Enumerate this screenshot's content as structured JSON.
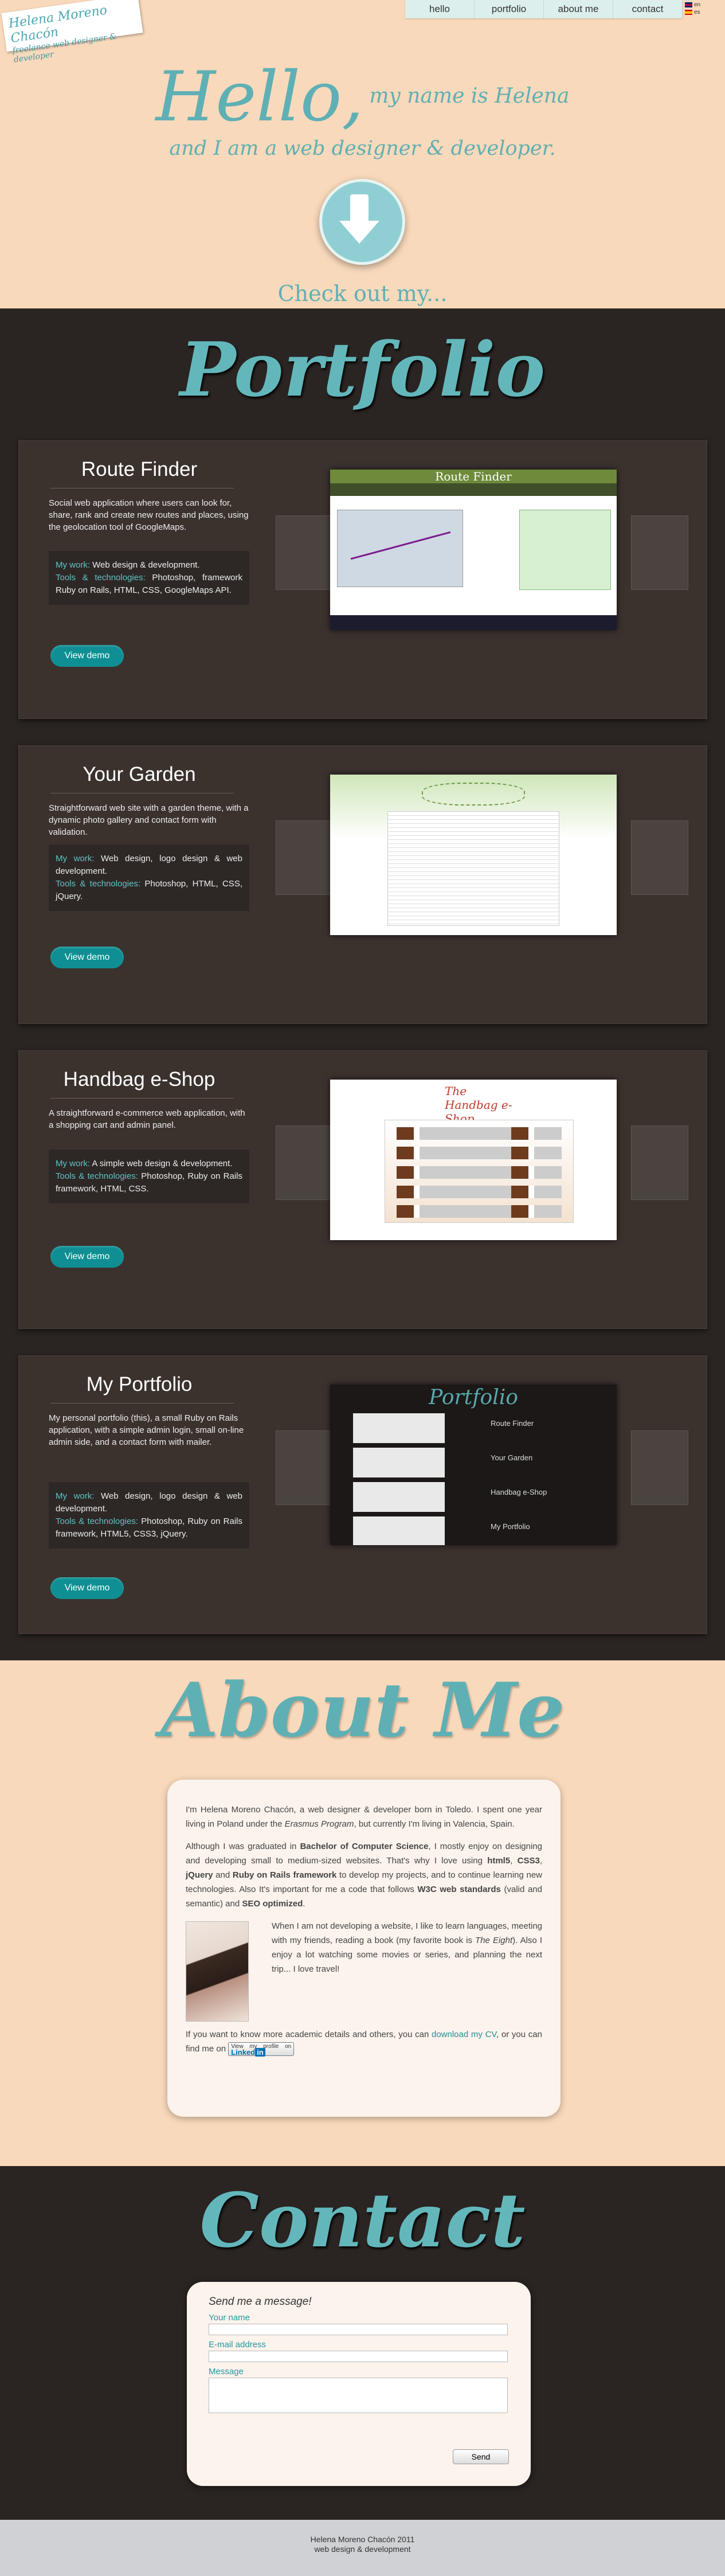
{
  "nav": {
    "items": [
      "hello",
      "portfolio",
      "about me",
      "contact"
    ],
    "languages": [
      "en",
      "es"
    ]
  },
  "logo": {
    "name": "Helena Moreno Chacón",
    "tagline": "freelance web designer & developer"
  },
  "hello": {
    "greeting": "Hello,",
    "line1": "my name is Helena",
    "line2": "and I am a web designer & developer.",
    "check_out": "Check out my..."
  },
  "portfolio": {
    "title": "Portfolio",
    "projects": [
      {
        "title": "Route Finder",
        "description": "Social web application where users can look for, share, rank and create new routes and places, using the geolocation tool of GoogleMaps.",
        "work_label": "My work:",
        "work": "Web design & development.",
        "tools_label": "Tools & technologies:",
        "tools": "Photoshop, framework Ruby on Rails, HTML, CSS, GoogleMaps API.",
        "button": "View demo",
        "shot_header": "Route Finder"
      },
      {
        "title": "Your Garden",
        "description": "Straightforward web site with a garden theme, with a dynamic photo gallery and contact form with validation.",
        "work_label": "My work:",
        "work": "Web design, logo design & web development.",
        "tools_label": "Tools & technologies:",
        "tools": "Photoshop, HTML, CSS, jQuery.",
        "button": "View demo"
      },
      {
        "title": "Handbag e-Shop",
        "description": "A straightforward e-commerce web application, with a shopping cart and admin panel.",
        "work_label": "My work:",
        "work": "A simple web design & development.",
        "tools_label": "Tools & technologies:",
        "tools": "Photoshop, Ruby on Rails framework, HTML, CSS.",
        "button": "View demo",
        "shot_logo": "The Handbag e-Shop"
      },
      {
        "title": "My Portfolio",
        "description": "My personal portfolio (this), a small Ruby on Rails application, with a simple admin login, small on-line admin side, and a contact form with mailer.",
        "work_label": "My work:",
        "work": "Web design, logo design & web development.",
        "tools_label": "Tools & technologies:",
        "tools": "Photoshop, Ruby on Rails framework, HTML5, CSS3, jQuery.",
        "button": "View demo",
        "shot_title": "Portfolio",
        "shot_rows": [
          "Route Finder",
          "Your Garden",
          "Handbag e-Shop",
          "My Portfolio"
        ]
      }
    ]
  },
  "about": {
    "title": "About Me",
    "p1_a": "I'm Helena Moreno Chacón, a web designer & developer born in Toledo. I spent one year living in Poland under the ",
    "p1_em": "Erasmus Program",
    "p1_b": ", but currently I'm living in Valencia, Spain.",
    "p2_a": "Although I was graduated in ",
    "p2_b1": "Bachelor of Computer Science",
    "p2_c": ", I mostly enjoy on designing and developing small to medium-sized websites. That's why I love using ",
    "p2_b2": "html5",
    "p2_d": ", ",
    "p2_b3": "CSS3",
    "p2_e": ", ",
    "p2_b4": "jQuery",
    "p2_f": " and ",
    "p2_b5": "Ruby on Rails framework",
    "p2_g": " to develop my projects, and to continue learning new technologies. Also It's important for me a code that follows ",
    "p2_b6": "W3C web standards",
    "p2_h": " (valid and semantic) and ",
    "p2_b7": "SEO optimized",
    "p2_i": ".",
    "p3_a": "When I am not developing a website, I like to learn languages, meeting with my friends, reading a book (my favorite book is ",
    "p3_em": "The Eight",
    "p3_b": "). Also I enjoy a lot watching some movies or series, and planning the next trip... I love travel!",
    "p4_a": "If you want to know more academic details and others, you can ",
    "p4_link": "download my CV",
    "p4_b": ", or you can find me on",
    "linkedin_small": "View my profile on",
    "linkedin_brand": "Linked",
    "linkedin_in": "in"
  },
  "contact": {
    "title": "Contact",
    "heading": "Send me a message!",
    "name_label": "Your name",
    "email_label": "E-mail address",
    "message_label": "Message",
    "send": "Send"
  },
  "footer": {
    "line1": "Helena Moreno Chacón 2011",
    "line2": "web design & development"
  },
  "colors": {
    "accent": "#5fb0b4",
    "peach": "#f9d9bb",
    "dark": "#2a2523",
    "panel": "#3b322e",
    "button": "#0f8f93"
  }
}
